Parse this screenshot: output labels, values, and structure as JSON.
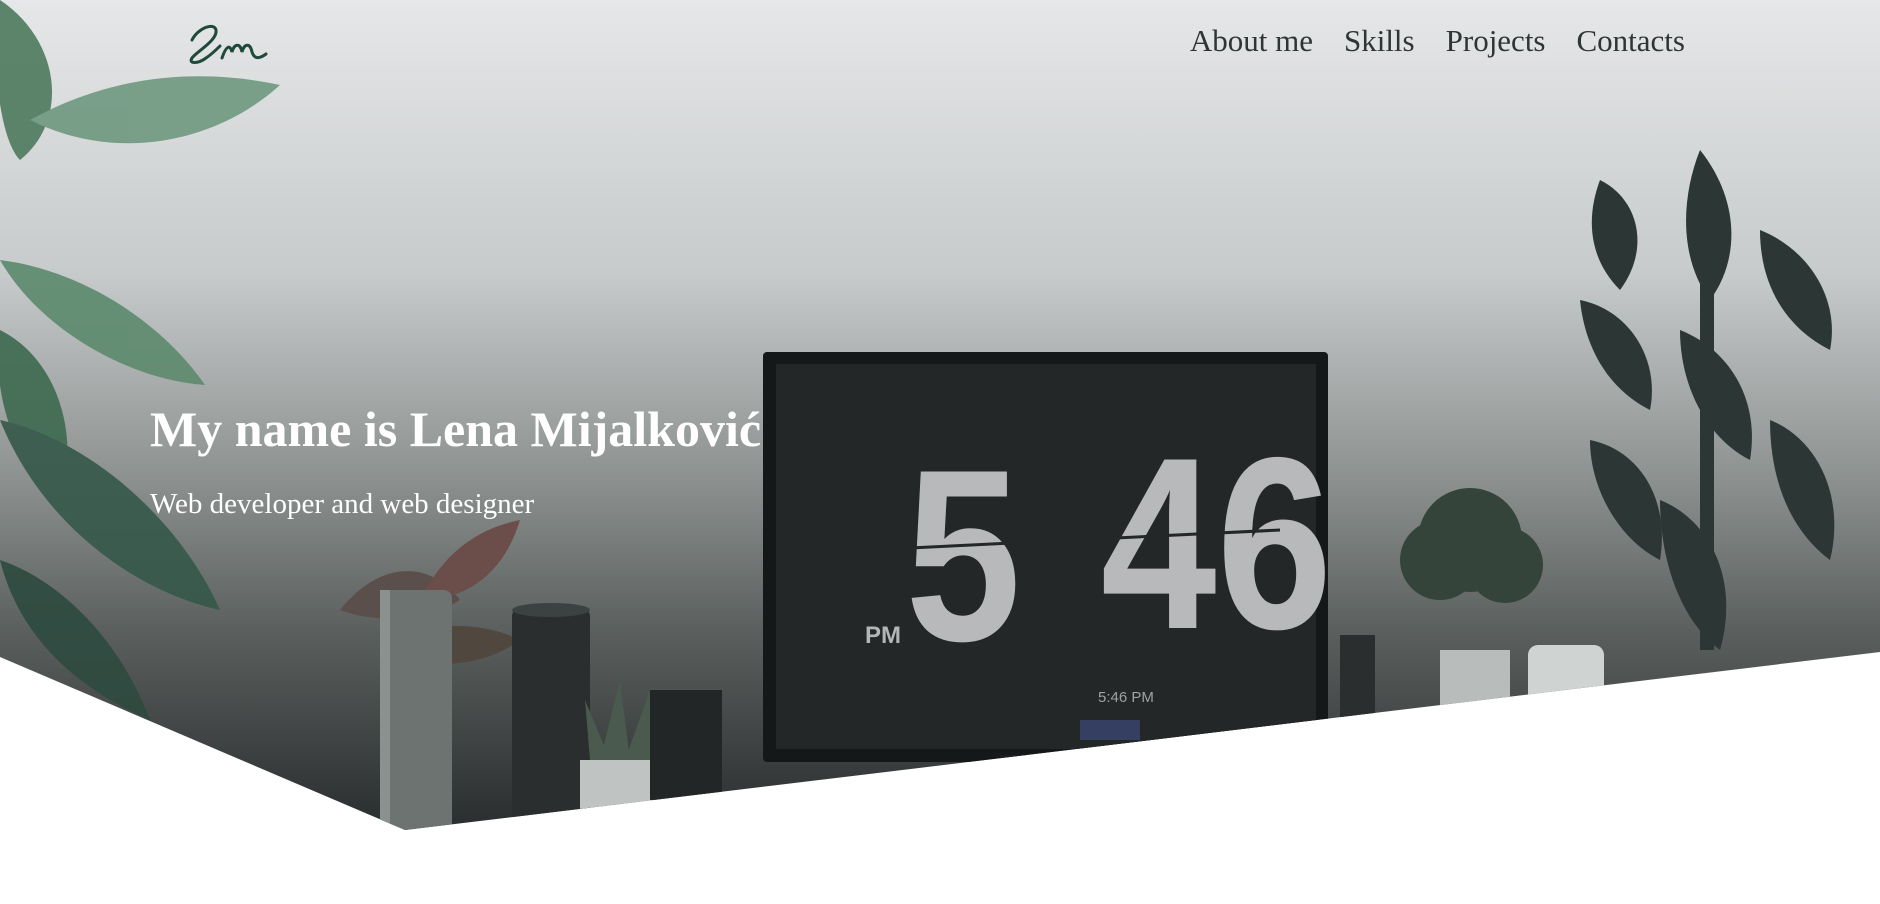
{
  "logo": {
    "text": "Lm"
  },
  "nav": {
    "items": [
      {
        "label": "About me"
      },
      {
        "label": "Skills"
      },
      {
        "label": "Projects"
      },
      {
        "label": "Contacts"
      }
    ]
  },
  "hero": {
    "title": "My name is Lena Mijalković",
    "subtitle": "Web developer and web designer",
    "clock": {
      "period": "PM",
      "hour": "5",
      "minutes": "46",
      "small_time": "5:46 PM"
    }
  },
  "colors": {
    "nav_text": "#2f3535",
    "hero_text": "#ffffff",
    "logo": "#1f4a3a"
  }
}
